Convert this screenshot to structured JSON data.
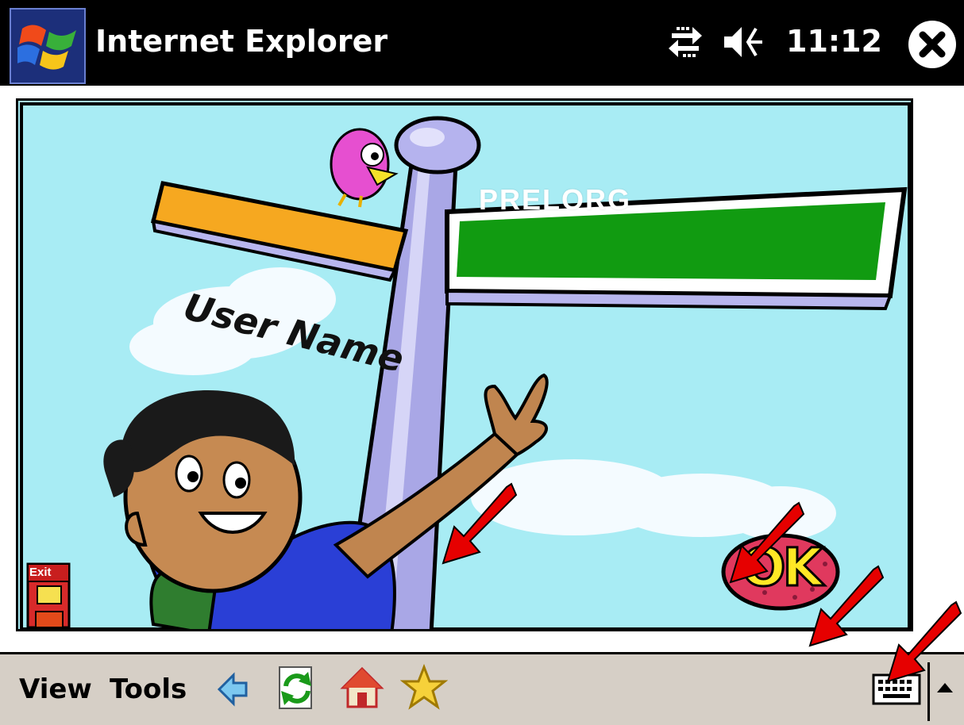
{
  "titlebar": {
    "app_title": "Internet Explorer",
    "clock": "11:12",
    "icons": [
      "windows-start-icon",
      "connectivity-icon",
      "speaker-muted-icon",
      "close-icon"
    ]
  },
  "page": {
    "sign_label": "User Name",
    "name_value": "PRELORG",
    "exit_label": "Exit",
    "ok_label": "OK"
  },
  "menubar": {
    "view_label": "View",
    "tools_label": "Tools",
    "icons": [
      "back-icon",
      "refresh-icon",
      "home-icon",
      "favorites-icon",
      "keyboard-icon",
      "sip-arrow-icon"
    ]
  },
  "annotations": {
    "arrow_color": "#e60000"
  }
}
